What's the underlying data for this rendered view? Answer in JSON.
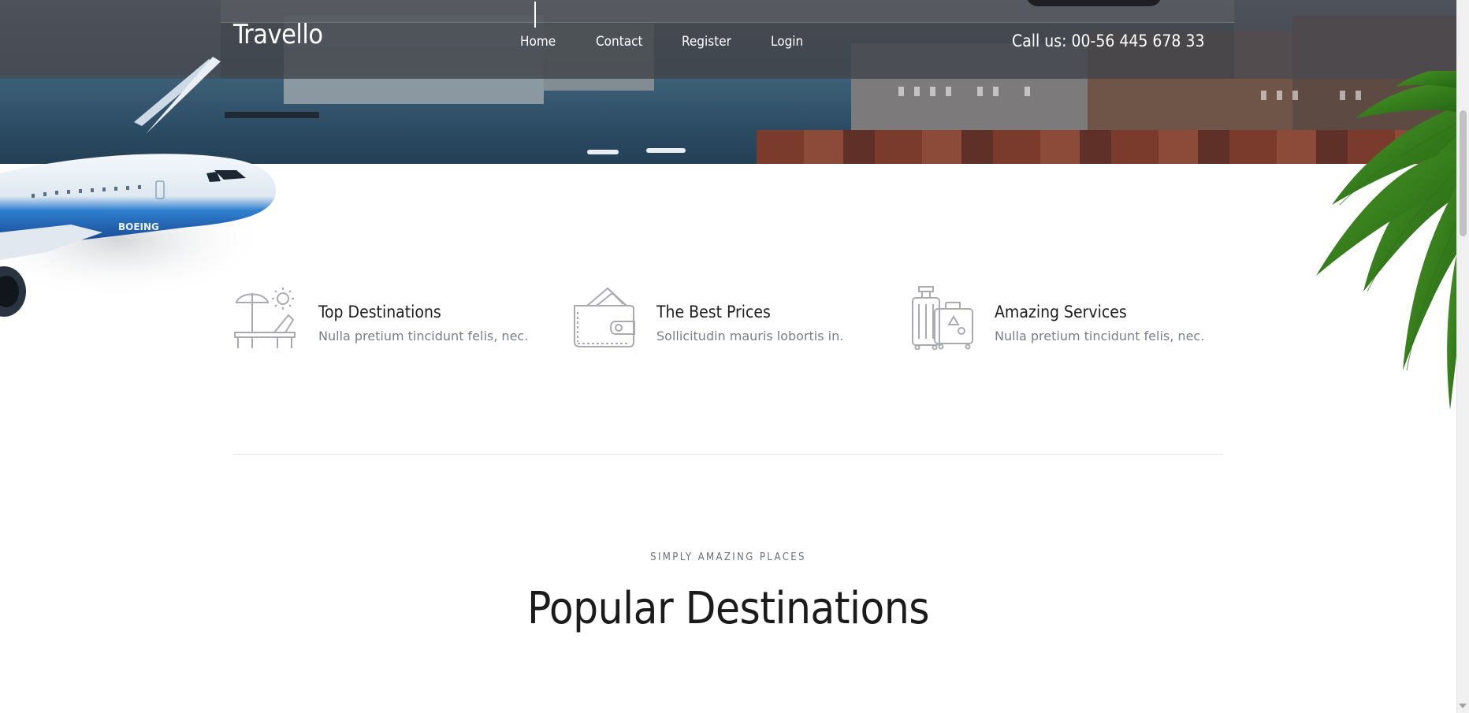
{
  "brand": "Travello",
  "nav": {
    "items": [
      "Home",
      "Contact",
      "Register",
      "Login"
    ]
  },
  "header": {
    "phone": "Call us: 00-56 445 678 33"
  },
  "features": [
    {
      "icon": "beach-chair-umbrella-icon",
      "title": "Top Destinations",
      "description": "Nulla pretium tincidunt felis, nec."
    },
    {
      "icon": "wallet-icon",
      "title": "The Best Prices",
      "description": "Sollicitudin mauris lobortis in."
    },
    {
      "icon": "luggage-icon",
      "title": "Amazing Services",
      "description": "Nulla pretium tincidunt felis, nec."
    }
  ],
  "section": {
    "eyebrow": "SIMPLY AMAZING PLACES",
    "title": "Popular Destinations"
  },
  "colors": {
    "header_overlay": "#464a50",
    "heading_text": "#1b1b1b",
    "muted_text": "#7a7e86",
    "icon_stroke": "#a9abb0",
    "divider": "#e3e4e6"
  }
}
